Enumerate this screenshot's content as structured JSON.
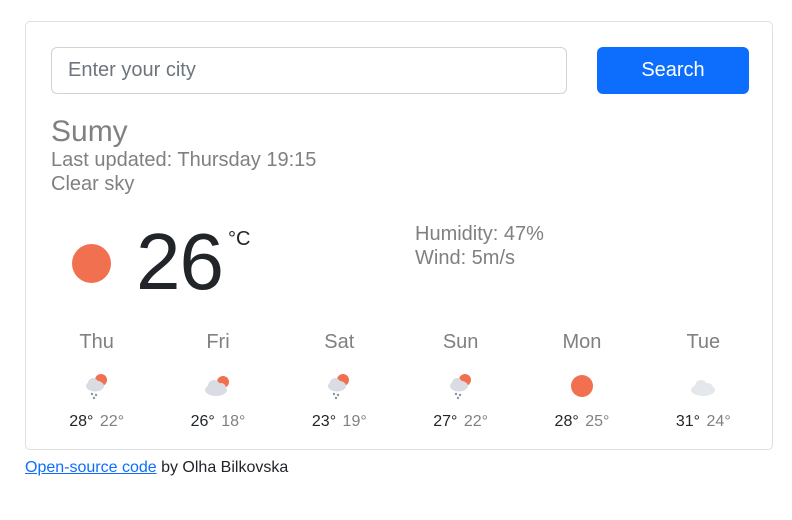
{
  "search": {
    "placeholder": "Enter your city",
    "button_label": "Search"
  },
  "current": {
    "city": "Sumy",
    "last_updated": "Last updated: Thursday 19:15",
    "description": "Clear sky",
    "temperature": "26",
    "unit": "°C",
    "humidity": "Humidity: 47%",
    "wind": "Wind: 5m/s",
    "icon": "sun-icon"
  },
  "forecast": [
    {
      "day": "Thu",
      "max": "28°",
      "min": "22°",
      "icon": "rain-sun-icon"
    },
    {
      "day": "Fri",
      "max": "26°",
      "min": "18°",
      "icon": "cloud-sun-icon"
    },
    {
      "day": "Sat",
      "max": "23°",
      "min": "19°",
      "icon": "rain-sun-icon"
    },
    {
      "day": "Sun",
      "max": "27°",
      "min": "22°",
      "icon": "rain-sun-icon"
    },
    {
      "day": "Mon",
      "max": "28°",
      "min": "25°",
      "icon": "sun-icon"
    },
    {
      "day": "Tue",
      "max": "31°",
      "min": "24°",
      "icon": "cloud-icon"
    }
  ],
  "footer": {
    "link_text": "Open-source code",
    "suffix": " by Olha Bilkovska"
  },
  "colors": {
    "accent": "#0d6efd",
    "sun": "#f0704f",
    "cloud": "#d9dde3",
    "muted_text": "#808080"
  }
}
